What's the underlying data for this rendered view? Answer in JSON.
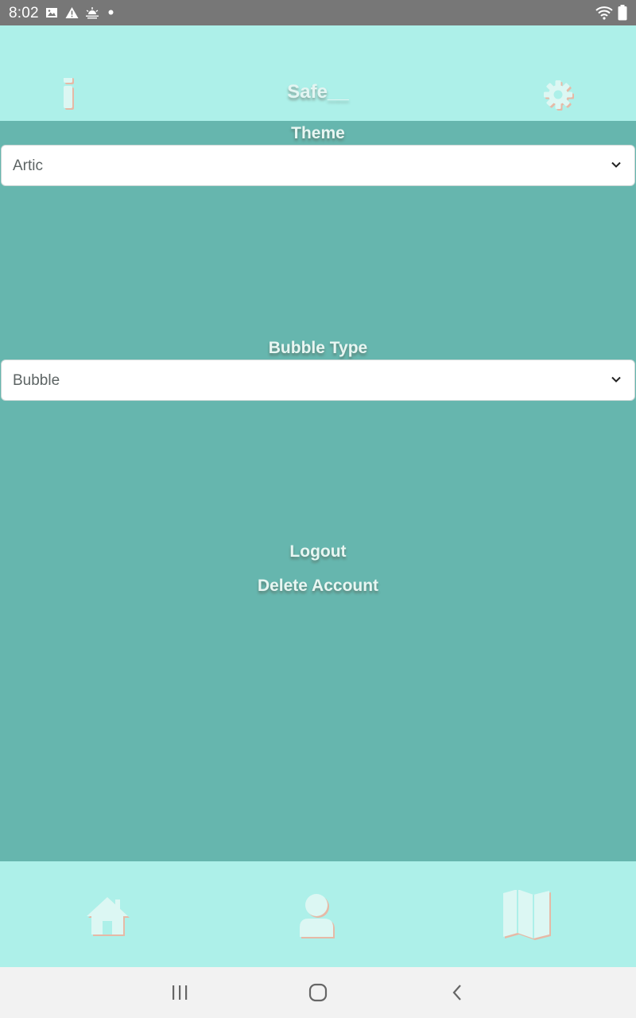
{
  "status_bar": {
    "time": "8:02",
    "icons": [
      "image-icon",
      "warning-icon",
      "weather-icon",
      "dot-icon",
      "wifi-icon",
      "battery-icon"
    ]
  },
  "app_bar": {
    "title": "Safe__",
    "icons": [
      "info-icon",
      "gear-icon"
    ]
  },
  "settings": {
    "theme_label": "Theme",
    "theme_value": "Artic",
    "bubble_label": "Bubble Type",
    "bubble_value": "Bubble",
    "logout_label": "Logout",
    "delete_label": "Delete Account"
  },
  "tab_bar": {
    "tabs": [
      "home-icon",
      "profile-icon",
      "map-icon"
    ]
  },
  "nav_bar": {
    "buttons": [
      "recents-icon",
      "home-circle-icon",
      "back-icon"
    ]
  },
  "colors": {
    "background": "#66b6ae",
    "bars": "#adf0e9",
    "text": "#e8f6f2",
    "status_bar": "#777777"
  }
}
